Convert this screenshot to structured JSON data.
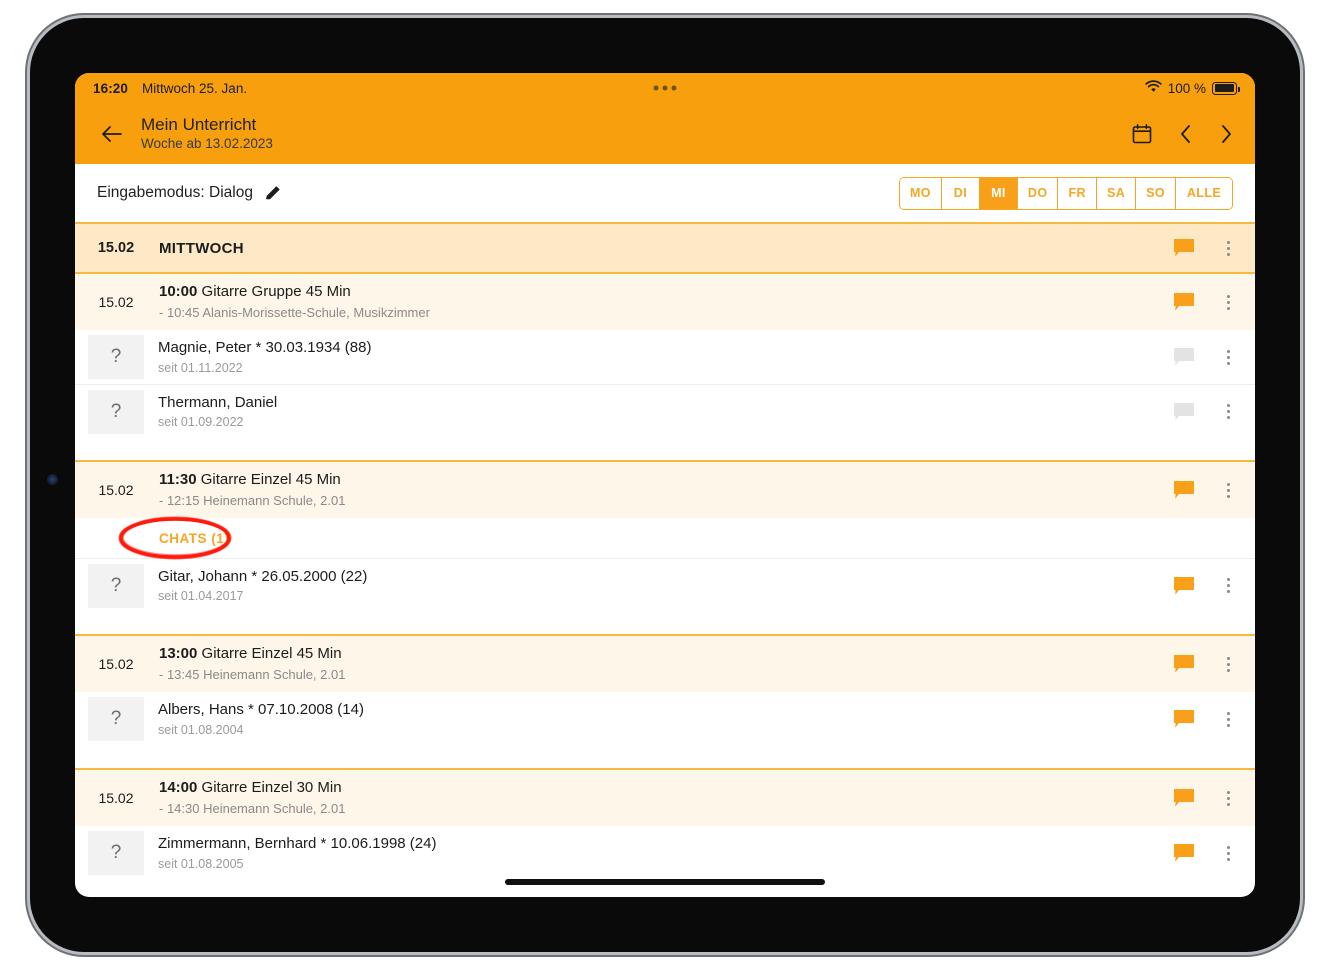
{
  "status_bar": {
    "time": "16:20",
    "date": "Mittwoch 25. Jan.",
    "battery_percent": "100 %",
    "wifi_icon": "wifi-icon",
    "battery_icon": "battery-full-icon"
  },
  "app_bar": {
    "back_icon": "arrow-left-icon",
    "title": "Mein Unterricht",
    "subtitle": "Woche ab 13.02.2023",
    "calendar_icon": "calendar-icon",
    "prev_icon": "chevron-left-icon",
    "next_icon": "chevron-right-icon"
  },
  "mode_bar": {
    "label": "Eingabemodus: Dialog",
    "edit_icon": "pencil-icon",
    "days": [
      {
        "label": "MO",
        "selected": false
      },
      {
        "label": "DI",
        "selected": false
      },
      {
        "label": "MI",
        "selected": true
      },
      {
        "label": "DO",
        "selected": false
      },
      {
        "label": "FR",
        "selected": false
      },
      {
        "label": "SA",
        "selected": false
      },
      {
        "label": "SO",
        "selected": false
      },
      {
        "label": "ALLE",
        "selected": false
      }
    ]
  },
  "day_header": {
    "date": "15.02",
    "name": "MITTWOCH",
    "chat_active": true
  },
  "lessons": [
    {
      "date": "15.02",
      "time": "10:00",
      "title": "Gitarre Gruppe 45 Min",
      "sub": "- 10:45 Alanis-Morissette-Schule, Musikzimmer",
      "chat_active": true,
      "chats_link": null,
      "students": [
        {
          "avatar": "?",
          "name": "Magnie, Peter * 30.03.1934 (88)",
          "sub": "seit 01.11.2022",
          "chat_active": false
        },
        {
          "avatar": "?",
          "name": "Thermann, Daniel",
          "sub": "seit 01.09.2022",
          "chat_active": false
        }
      ]
    },
    {
      "date": "15.02",
      "time": "11:30",
      "title": "Gitarre Einzel 45 Min",
      "sub": "- 12:15 Heinemann Schule, 2.01",
      "chat_active": true,
      "chats_link": "CHATS (1)",
      "students": [
        {
          "avatar": "?",
          "name": "Gitar, Johann * 26.05.2000 (22)",
          "sub": "seit 01.04.2017",
          "chat_active": true
        }
      ]
    },
    {
      "date": "15.02",
      "time": "13:00",
      "title": "Gitarre Einzel 45 Min",
      "sub": "- 13:45 Heinemann Schule, 2.01",
      "chat_active": true,
      "chats_link": null,
      "students": [
        {
          "avatar": "?",
          "name": "Albers, Hans * 07.10.2008 (14)",
          "sub": "seit 01.08.2004",
          "chat_active": true
        }
      ]
    },
    {
      "date": "15.02",
      "time": "14:00",
      "title": "Gitarre Einzel 30 Min",
      "sub": "- 14:30 Heinemann Schule, 2.01",
      "chat_active": true,
      "chats_link": null,
      "students": [
        {
          "avatar": "?",
          "name": "Zimmermann, Bernhard * 10.06.1998 (24)",
          "sub": "seit 01.08.2005",
          "chat_active": true
        }
      ]
    }
  ],
  "annotation": {
    "shape": "red-ellipse-highlight",
    "target": "CHATS (1)",
    "color": "#FF1A0D"
  },
  "colors": {
    "brand_orange": "#F79F0C",
    "accent_orange": "#F5A623",
    "header_cream": "#FDE9C6",
    "row_cream": "#FEF6E9",
    "gold_rule": "#F5B942",
    "inactive_gray": "#E3E3E3"
  }
}
